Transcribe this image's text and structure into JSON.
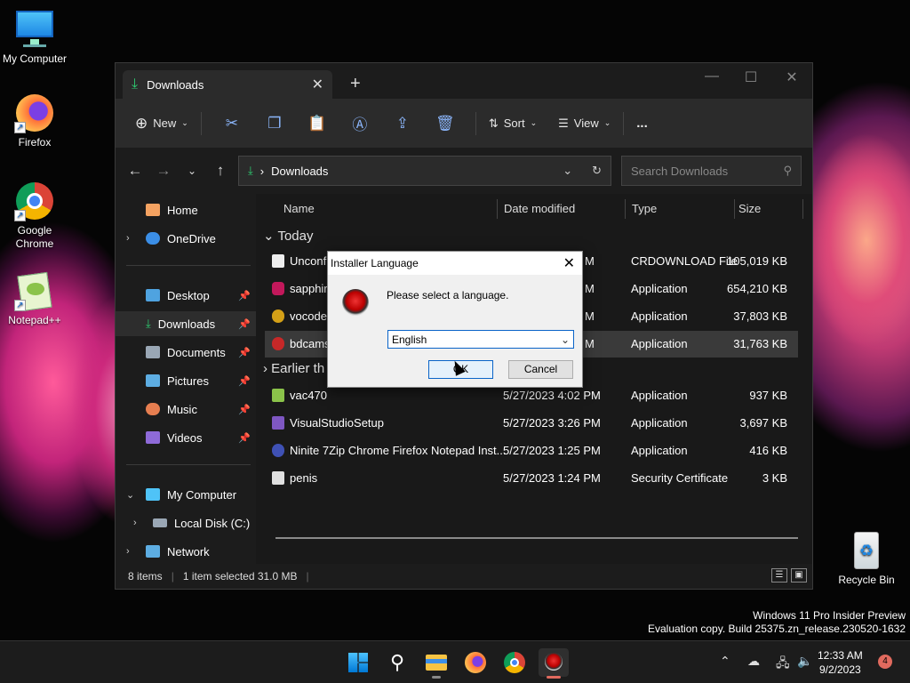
{
  "desktop": {
    "icons": [
      {
        "label": "My Computer",
        "icon": "monitor-icon"
      },
      {
        "label": "Firefox",
        "icon": "firefox-icon"
      },
      {
        "label": "Google Chrome",
        "icon": "chrome-icon"
      },
      {
        "label": "Notepad++",
        "icon": "notepadpp-icon"
      },
      {
        "label": "Recycle Bin",
        "icon": "recycle-bin-icon"
      }
    ],
    "watermark": {
      "line1": "Windows 11 Pro Insider Preview",
      "line2": "Evaluation copy. Build 25375.zn_release.230520-1632"
    }
  },
  "explorer": {
    "tab_title": "Downloads",
    "toolbar": {
      "new": "New",
      "sort": "Sort",
      "view": "View",
      "more": "..."
    },
    "address": {
      "path": "Downloads",
      "search_placeholder": "Search Downloads"
    },
    "sidebar": {
      "home": "Home",
      "onedrive": "OneDrive",
      "pinned": [
        "Desktop",
        "Downloads",
        "Documents",
        "Pictures",
        "Music",
        "Videos"
      ],
      "mycomputer": "My Computer",
      "localdisk": "Local Disk (C:)",
      "network": "Network"
    },
    "columns": {
      "name": "Name",
      "date": "Date modified",
      "type": "Type",
      "size": "Size"
    },
    "groups": {
      "today": "Today",
      "earlier": "Earlier th"
    },
    "today_files": [
      {
        "name": "Unconfi",
        "date": "M",
        "type": "CRDOWNLOAD File",
        "size": "105,019 KB"
      },
      {
        "name": "sapphire",
        "date": "M",
        "type": "Application",
        "size": "654,210 KB"
      },
      {
        "name": "vocodex",
        "date": "M",
        "type": "Application",
        "size": "37,803 KB"
      },
      {
        "name": "bdcams",
        "date": "M",
        "type": "Application",
        "size": "31,763 KB"
      }
    ],
    "earlier_files": [
      {
        "name": "vac470",
        "date": "5/27/2023 4:02 PM",
        "type": "Application",
        "size": "937 KB"
      },
      {
        "name": "VisualStudioSetup",
        "date": "5/27/2023 3:26 PM",
        "type": "Application",
        "size": "3,697 KB"
      },
      {
        "name": "Ninite 7Zip Chrome Firefox Notepad Inst...",
        "date": "5/27/2023 1:25 PM",
        "type": "Application",
        "size": "416 KB"
      },
      {
        "name": "penis",
        "date": "5/27/2023 1:24 PM",
        "type": "Security Certificate",
        "size": "3 KB"
      }
    ],
    "status": {
      "items": "8 items",
      "selected": "1 item selected  31.0 MB"
    }
  },
  "dialog": {
    "title": "Installer Language",
    "message": "Please select a language.",
    "selected_language": "English",
    "ok": "OK",
    "cancel": "Cancel"
  },
  "taskbar": {
    "time": "12:33 AM",
    "date": "9/2/2023",
    "notifications": "4"
  }
}
